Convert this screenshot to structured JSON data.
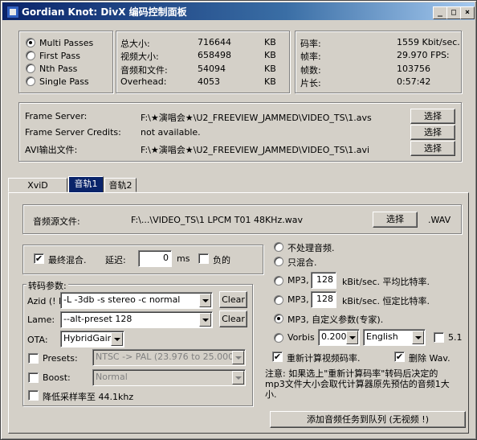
{
  "window": {
    "title": "Gordian Knot: DivX 编码控制面板"
  },
  "passes": {
    "options": [
      "Multi  Passes",
      "First      Pass",
      "Nth Pass",
      "Single   Pass"
    ],
    "selected": 0
  },
  "sizes": {
    "rows": [
      {
        "label": "总大小:",
        "value": "716644",
        "unit": "KB"
      },
      {
        "label": "视频大小:",
        "value": "658498",
        "unit": "KB"
      },
      {
        "label": "音频和文件:",
        "value": "54094",
        "unit": "KB"
      },
      {
        "label": "Overhead:",
        "value": "4053",
        "unit": "KB"
      }
    ]
  },
  "stats": {
    "rows": [
      {
        "label": "码率:",
        "value": "1559 Kbit/sec."
      },
      {
        "label": "帧率:",
        "value": "29.970 FPS:"
      },
      {
        "label": "帧数:",
        "value": "103756"
      },
      {
        "label": "片长:",
        "value": "0:57:42"
      }
    ]
  },
  "files": {
    "rows": [
      {
        "label": "Frame Server:",
        "value": "F:\\★演唱会★\\U2_FREEVIEW_JAMMED\\VIDEO_TS\\1.avs",
        "button": "选择"
      },
      {
        "label": "Frame Server Credits:",
        "value": "not available.",
        "button": "选择"
      },
      {
        "label": "AVI输出文件:",
        "value": "F:\\★演唱会★\\U2_FREEVIEW_JAMMED\\VIDEO_TS\\1.avi",
        "button": "选择"
      }
    ]
  },
  "tabs": [
    "XviD",
    "音轨1",
    "音轨2"
  ],
  "audio_source": {
    "label": "音频源文件:",
    "value": "F:\\...\\VIDEO_TS\\1 LPCM T01 48KHz.wav",
    "button": "选择",
    "ext": ".WAV"
  },
  "mix": {
    "final_mix_label": "最终混合.",
    "final_mix_checked": "✔",
    "delay_label": "延迟:",
    "delay_value": "0",
    "ms": "ms",
    "negative_label": "负的"
  },
  "encode": {
    "group_label": "转码参数:",
    "azid_label": "Azid (! D",
    "azid_value": "-L -3db -s stereo -c normal",
    "lame_label": "Lame:",
    "lame_value": "--alt-preset 128",
    "clear": "Clear",
    "ota_label": "OTA:",
    "ota_value": "HybridGain",
    "presets_label": "Presets:",
    "presets_value": "NTSC -> PAL (23.976 to 25.000)",
    "boost_label": "Boost:",
    "boost_value": "Normal",
    "resample_label": "降低采样率至 44.1khz"
  },
  "audio_mode": {
    "no_process": "不处理音频.",
    "mix_only": "只混合.",
    "mp3_avg_prefix": "MP3,",
    "mp3_avg_value": "128",
    "mp3_avg_suffix": "kBit/sec. 平均比特率.",
    "mp3_cbr_prefix": "MP3,",
    "mp3_cbr_value": "128",
    "mp3_cbr_suffix": "kBit/sec. 恒定比特率.",
    "mp3_custom": "MP3, 自定义参数(专家).",
    "vorbis_label": "Vorbis",
    "vorbis_quality": "0.200",
    "vorbis_lang": "English",
    "surround_label": "5.1",
    "recalc_label": "重新计算视频码率.",
    "delete_wav_label": "删除 Wav.",
    "selected": 4
  },
  "note": "注意: 如果选上\"重新计算码率\"转码后决定的mp3文件大小会取代计算器原先预估的音频1大小.",
  "add_job_button": "添加音频任务到队列 (无视频 !)"
}
